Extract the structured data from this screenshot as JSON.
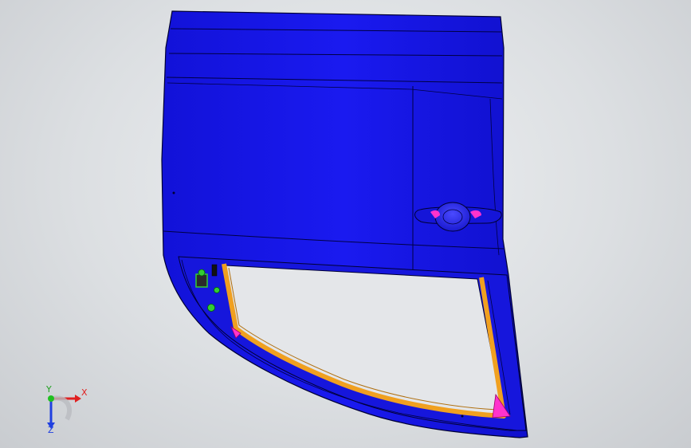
{
  "viewport": {
    "background_colors": [
      "#eef0f2",
      "#c9ccd0"
    ]
  },
  "model": {
    "part": "door-panel",
    "body_color": "#1a1ae6",
    "edge_color": "#000033",
    "seal_color": "#f0a020",
    "highlight_color": "#ff33cc",
    "feature_color": "#33cc33"
  },
  "triad": {
    "x_label": "X",
    "y_label": "Y",
    "z_label": "Z",
    "x_color": "#e02020",
    "y_color": "#20c020",
    "z_color": "#2040e0"
  }
}
